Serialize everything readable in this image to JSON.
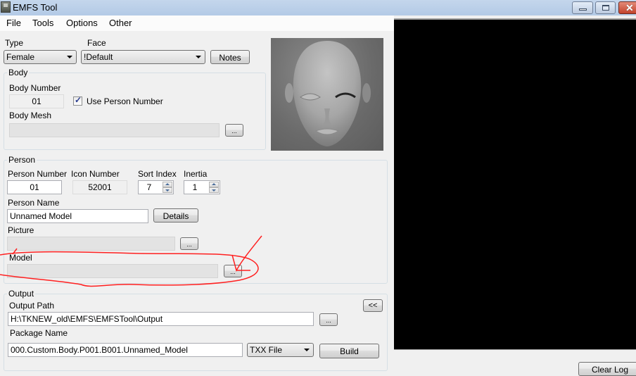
{
  "window": {
    "title": "EMFS Tool",
    "controls": {
      "minimize": "minimize",
      "maximize": "maximize",
      "close": "✕"
    }
  },
  "menu": [
    "File",
    "Tools",
    "Options",
    "Other"
  ],
  "top": {
    "type_label": "Type",
    "type_value": "Female",
    "face_label": "Face",
    "face_value": "!Default",
    "notes_button": "Notes"
  },
  "body": {
    "group_title": "Body",
    "body_number_label": "Body Number",
    "body_number_value": "01",
    "use_person_number_label": "Use Person Number",
    "use_person_number_checked": true,
    "body_mesh_label": "Body Mesh",
    "body_mesh_value": "",
    "browse_label": "..."
  },
  "person": {
    "group_title": "Person",
    "person_number_label": "Person Number",
    "person_number_value": "01",
    "icon_number_label": "Icon Number",
    "icon_number_value": "52001",
    "sort_index_label": "Sort Index",
    "sort_index_value": "7",
    "inertia_label": "Inertia",
    "inertia_value": "1",
    "person_name_label": "Person Name",
    "person_name_value": "Unnamed Model",
    "details_button": "Details",
    "picture_label": "Picture",
    "picture_value": "",
    "model_label": "Model",
    "model_value": "",
    "browse_label": "..."
  },
  "output": {
    "group_title": "Output",
    "output_path_label": "Output Path",
    "output_path_value": "H:\\TKNEW_old\\EMFS\\EMFSTool\\Output",
    "package_name_label": "Package Name",
    "package_name_value": "000.Custom.Body.P001.B001.Unnamed_Model",
    "format_value": "TXX File",
    "build_button": "Build",
    "collapse_button": "<<",
    "browse_label": "..."
  },
  "log": {
    "clear_button": "Clear Log"
  },
  "annotation": {
    "color": "#ff2020",
    "description": "red freehand circle and arrow around Model field"
  }
}
